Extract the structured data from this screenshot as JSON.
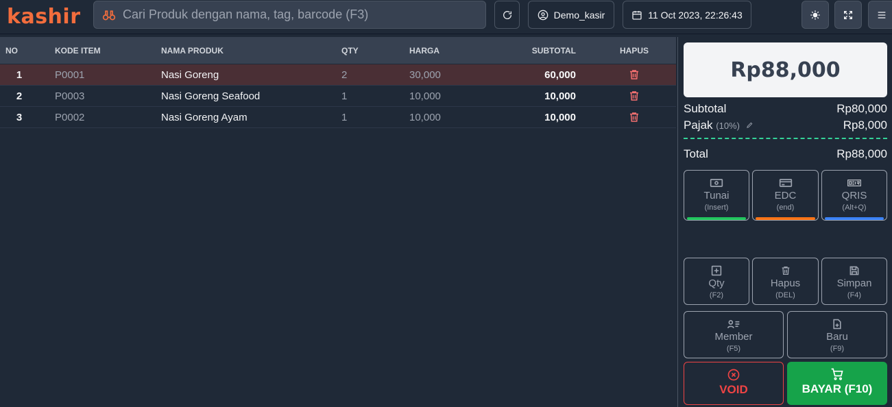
{
  "app": {
    "logo": "kashir"
  },
  "search": {
    "placeholder": "Cari Produk dengan nama, tag, barcode (F3)"
  },
  "header": {
    "user": "Demo_kasir",
    "datetime": "11 Oct 2023, 22:26:43"
  },
  "table": {
    "columns": [
      "NO",
      "KODE ITEM",
      "NAMA PRODUK",
      "QTY",
      "HARGA",
      "SUBTOTAL",
      "HAPUS"
    ],
    "rows": [
      {
        "no": "1",
        "code": "P0001",
        "name": "Nasi Goreng",
        "qty": "2",
        "price": "30,000",
        "subtotal": "60,000"
      },
      {
        "no": "2",
        "code": "P0003",
        "name": "Nasi Goreng Seafood",
        "qty": "1",
        "price": "10,000",
        "subtotal": "10,000"
      },
      {
        "no": "3",
        "code": "P0002",
        "name": "Nasi Goreng Ayam",
        "qty": "1",
        "price": "10,000",
        "subtotal": "10,000"
      }
    ]
  },
  "summary": {
    "grand_total": "Rp88,000",
    "subtotal_label": "Subtotal",
    "subtotal_value": "Rp80,000",
    "tax_label": "Pajak",
    "tax_rate": "(10%)",
    "tax_value": "Rp8,000",
    "total_label": "Total",
    "total_value": "Rp88,000"
  },
  "payment": [
    {
      "label": "Tunai",
      "key": "(Insert)",
      "color": "#22c55e"
    },
    {
      "label": "EDC",
      "key": "(end)",
      "color": "#f97316"
    },
    {
      "label": "QRIS",
      "key": "(Alt+Q)",
      "color": "#3b82f6"
    }
  ],
  "actions": {
    "qty": {
      "label": "Qty",
      "key": "(F2)"
    },
    "hapus": {
      "label": "Hapus",
      "key": "(DEL)"
    },
    "simpan": {
      "label": "Simpan",
      "key": "(F4)"
    },
    "member": {
      "label": "Member",
      "key": "(F5)"
    },
    "baru": {
      "label": "Baru",
      "key": "(F9)"
    },
    "void": "VOID",
    "bayar": "BAYAR (F10)"
  },
  "colors": {
    "brand": "#f26d3d",
    "accent_green": "#16a34a",
    "danger": "#ef4444"
  }
}
